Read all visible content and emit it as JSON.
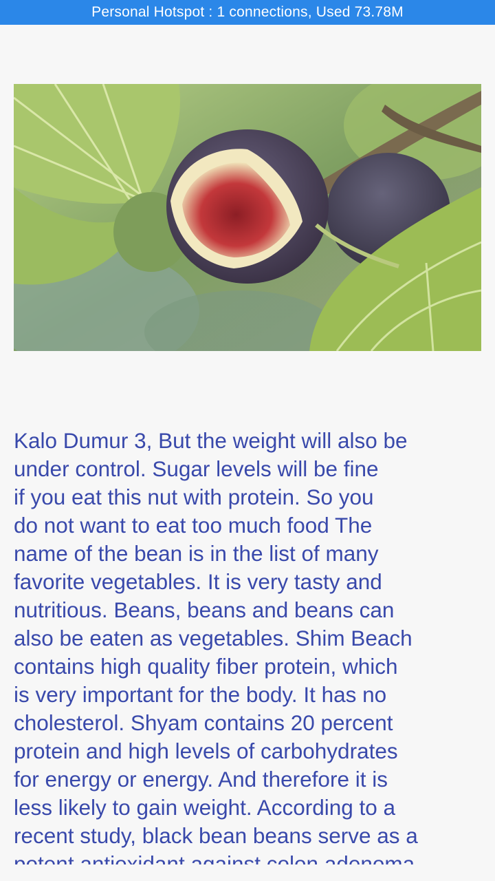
{
  "status_bar": {
    "text": "Personal Hotspot : 1 connections, Used 73.78M",
    "background": "#2b87e8"
  },
  "article": {
    "image_icon": "fig-fruit-photo",
    "body": "Kalo Dumur 3, But the weight will also be\nunder control. Sugar levels will be fine\nif you eat this nut with protein. So you\ndo not want to eat too much food The\nname of the bean is in the list of many\nfavorite vegetables. It is very tasty and\nnutritious. Beans, beans and beans can\nalso be eaten as vegetables. Shim Beach\ncontains high quality fiber protein, which\nis very important for the body. It has no\ncholesterol. Shyam contains 20 percent\nprotein and high levels of carbohydrates\nfor energy or energy. And therefore it is\nless likely to gain weight. According to a\nrecent study, black bean beans serve as a\npotent antioxidant against colon adenoma",
    "text_color": "#3949ab"
  }
}
